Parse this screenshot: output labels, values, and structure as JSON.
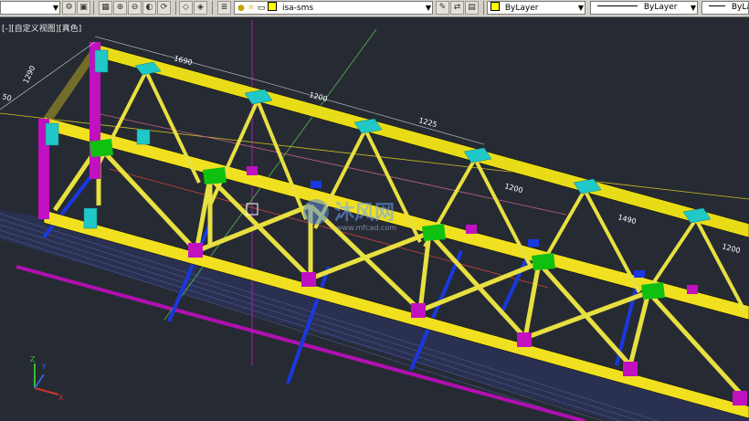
{
  "toolbar": {
    "layer_name": "isa-sms",
    "color_value": "ByLayer",
    "linetype_value": "ByLayer",
    "lineweight_value": "ByLa",
    "colors": {
      "bg": "#d4d0c8",
      "layer_swatch": "#ffff00"
    }
  },
  "viewport": {
    "label": "[-][自定义视图][真色]",
    "background": "#262b33"
  },
  "dimensions": [
    "1690",
    "1200",
    "1225",
    "1200",
    "1490",
    "1200",
    "1290",
    "50"
  ],
  "watermark": {
    "brand": "沐风网",
    "url": "www.mfcad.com"
  },
  "ucs": {
    "x": "X",
    "y": "Y",
    "z": "Z"
  },
  "colors": {
    "truss": "#f0e020",
    "brace": "#e8e040",
    "gusset_cyan": "#20c8c8",
    "post": "#c010c0",
    "blue": "#1838e0",
    "green": "#10c010"
  }
}
